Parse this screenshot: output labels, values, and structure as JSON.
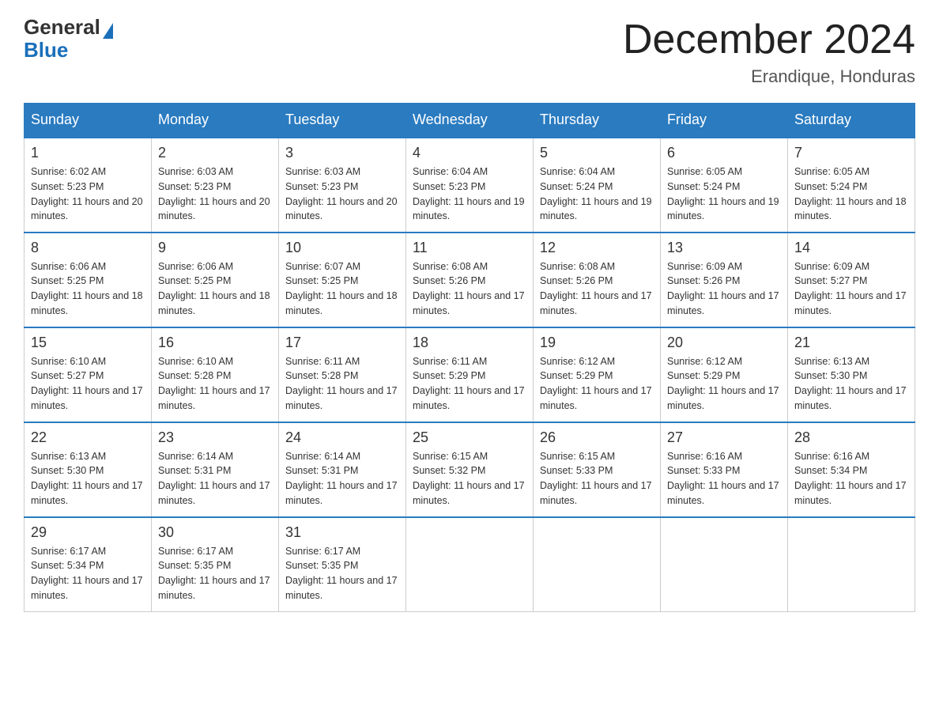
{
  "header": {
    "logo_general": "General",
    "logo_blue": "Blue",
    "month_title": "December 2024",
    "location": "Erandique, Honduras"
  },
  "weekdays": [
    "Sunday",
    "Monday",
    "Tuesday",
    "Wednesday",
    "Thursday",
    "Friday",
    "Saturday"
  ],
  "weeks": [
    [
      {
        "day": "1",
        "sunrise": "6:02 AM",
        "sunset": "5:23 PM",
        "daylight": "11 hours and 20 minutes."
      },
      {
        "day": "2",
        "sunrise": "6:03 AM",
        "sunset": "5:23 PM",
        "daylight": "11 hours and 20 minutes."
      },
      {
        "day": "3",
        "sunrise": "6:03 AM",
        "sunset": "5:23 PM",
        "daylight": "11 hours and 20 minutes."
      },
      {
        "day": "4",
        "sunrise": "6:04 AM",
        "sunset": "5:23 PM",
        "daylight": "11 hours and 19 minutes."
      },
      {
        "day": "5",
        "sunrise": "6:04 AM",
        "sunset": "5:24 PM",
        "daylight": "11 hours and 19 minutes."
      },
      {
        "day": "6",
        "sunrise": "6:05 AM",
        "sunset": "5:24 PM",
        "daylight": "11 hours and 19 minutes."
      },
      {
        "day": "7",
        "sunrise": "6:05 AM",
        "sunset": "5:24 PM",
        "daylight": "11 hours and 18 minutes."
      }
    ],
    [
      {
        "day": "8",
        "sunrise": "6:06 AM",
        "sunset": "5:25 PM",
        "daylight": "11 hours and 18 minutes."
      },
      {
        "day": "9",
        "sunrise": "6:06 AM",
        "sunset": "5:25 PM",
        "daylight": "11 hours and 18 minutes."
      },
      {
        "day": "10",
        "sunrise": "6:07 AM",
        "sunset": "5:25 PM",
        "daylight": "11 hours and 18 minutes."
      },
      {
        "day": "11",
        "sunrise": "6:08 AM",
        "sunset": "5:26 PM",
        "daylight": "11 hours and 17 minutes."
      },
      {
        "day": "12",
        "sunrise": "6:08 AM",
        "sunset": "5:26 PM",
        "daylight": "11 hours and 17 minutes."
      },
      {
        "day": "13",
        "sunrise": "6:09 AM",
        "sunset": "5:26 PM",
        "daylight": "11 hours and 17 minutes."
      },
      {
        "day": "14",
        "sunrise": "6:09 AM",
        "sunset": "5:27 PM",
        "daylight": "11 hours and 17 minutes."
      }
    ],
    [
      {
        "day": "15",
        "sunrise": "6:10 AM",
        "sunset": "5:27 PM",
        "daylight": "11 hours and 17 minutes."
      },
      {
        "day": "16",
        "sunrise": "6:10 AM",
        "sunset": "5:28 PM",
        "daylight": "11 hours and 17 minutes."
      },
      {
        "day": "17",
        "sunrise": "6:11 AM",
        "sunset": "5:28 PM",
        "daylight": "11 hours and 17 minutes."
      },
      {
        "day": "18",
        "sunrise": "6:11 AM",
        "sunset": "5:29 PM",
        "daylight": "11 hours and 17 minutes."
      },
      {
        "day": "19",
        "sunrise": "6:12 AM",
        "sunset": "5:29 PM",
        "daylight": "11 hours and 17 minutes."
      },
      {
        "day": "20",
        "sunrise": "6:12 AM",
        "sunset": "5:29 PM",
        "daylight": "11 hours and 17 minutes."
      },
      {
        "day": "21",
        "sunrise": "6:13 AM",
        "sunset": "5:30 PM",
        "daylight": "11 hours and 17 minutes."
      }
    ],
    [
      {
        "day": "22",
        "sunrise": "6:13 AM",
        "sunset": "5:30 PM",
        "daylight": "11 hours and 17 minutes."
      },
      {
        "day": "23",
        "sunrise": "6:14 AM",
        "sunset": "5:31 PM",
        "daylight": "11 hours and 17 minutes."
      },
      {
        "day": "24",
        "sunrise": "6:14 AM",
        "sunset": "5:31 PM",
        "daylight": "11 hours and 17 minutes."
      },
      {
        "day": "25",
        "sunrise": "6:15 AM",
        "sunset": "5:32 PM",
        "daylight": "11 hours and 17 minutes."
      },
      {
        "day": "26",
        "sunrise": "6:15 AM",
        "sunset": "5:33 PM",
        "daylight": "11 hours and 17 minutes."
      },
      {
        "day": "27",
        "sunrise": "6:16 AM",
        "sunset": "5:33 PM",
        "daylight": "11 hours and 17 minutes."
      },
      {
        "day": "28",
        "sunrise": "6:16 AM",
        "sunset": "5:34 PM",
        "daylight": "11 hours and 17 minutes."
      }
    ],
    [
      {
        "day": "29",
        "sunrise": "6:17 AM",
        "sunset": "5:34 PM",
        "daylight": "11 hours and 17 minutes."
      },
      {
        "day": "30",
        "sunrise": "6:17 AM",
        "sunset": "5:35 PM",
        "daylight": "11 hours and 17 minutes."
      },
      {
        "day": "31",
        "sunrise": "6:17 AM",
        "sunset": "5:35 PM",
        "daylight": "11 hours and 17 minutes."
      },
      null,
      null,
      null,
      null
    ]
  ],
  "labels": {
    "sunrise": "Sunrise: ",
    "sunset": "Sunset: ",
    "daylight": "Daylight: "
  }
}
